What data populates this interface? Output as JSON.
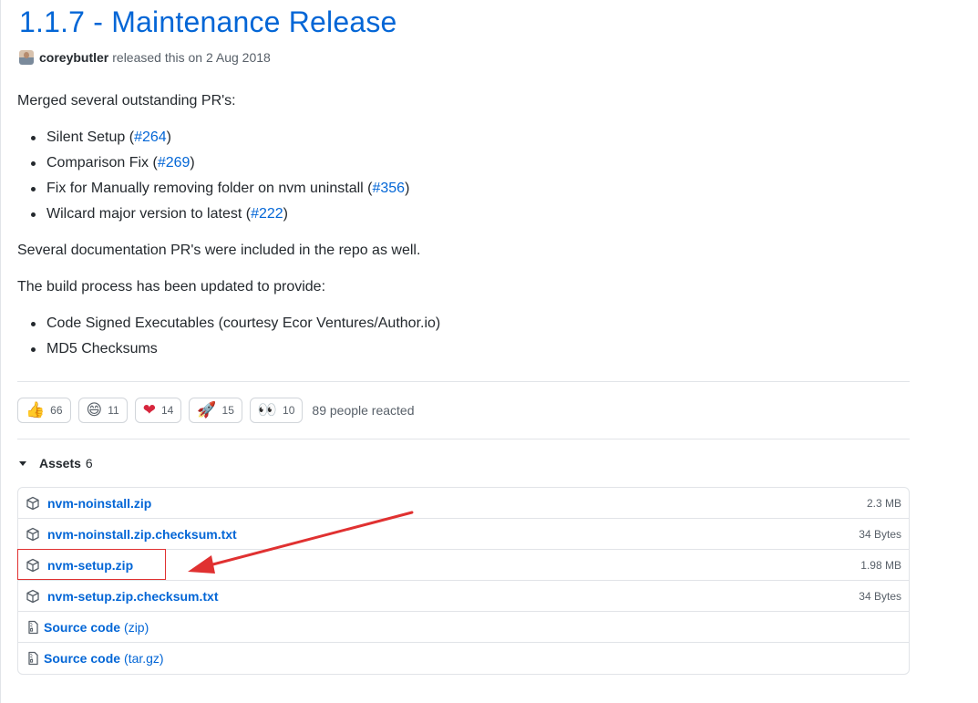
{
  "release": {
    "title": "1.1.7 - Maintenance Release",
    "author": "coreybutler",
    "released_text": "released this on 2 Aug 2018"
  },
  "notes": {
    "intro": "Merged several outstanding PR's:",
    "prs": [
      {
        "text": "Silent Setup (",
        "ref": "#264",
        "end": ")"
      },
      {
        "text": "Comparison Fix (",
        "ref": "#269",
        "end": ")"
      },
      {
        "text": "Fix for Manually removing folder on nvm uninstall (",
        "ref": "#356",
        "end": ")"
      },
      {
        "text": "Wilcard major version to latest (",
        "ref": "#222",
        "end": ")"
      }
    ],
    "docs_line": "Several documentation PR's were included in the repo as well.",
    "build_line": "The build process has been updated to provide:",
    "build_items": [
      "Code Signed Executables (courtesy Ecor Ventures/Author.io)",
      "MD5 Checksums"
    ]
  },
  "reactions": {
    "items": [
      {
        "emoji": "👍",
        "icon": "thumbs-up-icon",
        "count": "66"
      },
      {
        "emoji": "😄",
        "icon": "laugh-icon",
        "count": "11"
      },
      {
        "emoji": "❤",
        "icon": "heart-icon",
        "count": "14"
      },
      {
        "emoji": "🚀",
        "icon": "rocket-icon",
        "count": "15"
      },
      {
        "emoji": "👀",
        "icon": "eyes-icon",
        "count": "10"
      }
    ],
    "summary": "89 people reacted"
  },
  "assets": {
    "label": "Assets",
    "count": "6",
    "files": [
      {
        "name": "nvm-noinstall.zip",
        "size": "2.3 MB"
      },
      {
        "name": "nvm-noinstall.zip.checksum.txt",
        "size": "34 Bytes"
      },
      {
        "name": "nvm-setup.zip",
        "size": "1.98 MB"
      },
      {
        "name": "nvm-setup.zip.checksum.txt",
        "size": "34 Bytes"
      }
    ],
    "sources": [
      {
        "name": "Source code",
        "ext": "(zip)"
      },
      {
        "name": "Source code",
        "ext": "(tar.gz)"
      }
    ]
  },
  "colors": {
    "link": "#0366d6",
    "annotation": "#e03131"
  }
}
